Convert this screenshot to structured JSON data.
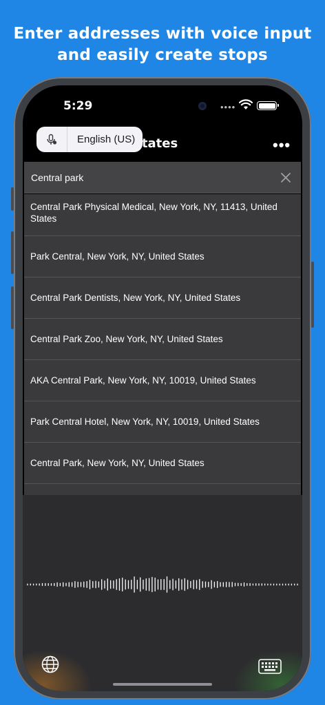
{
  "promo": {
    "line1": "Enter addresses with voice input",
    "line2": "and easily create stops"
  },
  "status_bar": {
    "time": "5:29"
  },
  "header": {
    "title_visible": "ted States",
    "more_icon": "ellipsis-icon"
  },
  "language_popover": {
    "mic_icon": "microphone-icon",
    "language": "English (US)"
  },
  "search": {
    "value": "Central park",
    "clear_icon": "close-icon"
  },
  "results": [
    "Central Park Physical Medical, New York, NY, 11413, United States",
    "Park Central, New York, NY, United States",
    "Central Park Dentists, New York, NY, United States",
    "Central Park Zoo, New York, NY, United States",
    "AKA Central Park, New York, NY, 10019, United States",
    "Park Central Hotel, New York, NY, 10019, United States",
    "Central Park, New York, NY, United States"
  ],
  "voice_bar": {
    "globe_icon": "globe-icon",
    "keyboard_icon": "keyboard-icon"
  },
  "colors": {
    "background": "#1f86e6",
    "screen": "#000000",
    "row_bg": "#3a3a3c",
    "popover_bg": "#f2f2f7"
  }
}
